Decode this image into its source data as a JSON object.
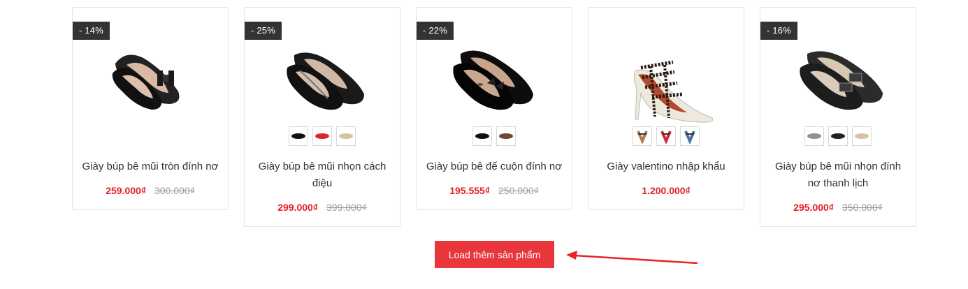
{
  "products": [
    {
      "badge": "- 14%",
      "name": "Giày búp bê mũi tròn đính nơ",
      "price": "259.000₫",
      "old_price": "300.000₫"
    },
    {
      "badge": "- 25%",
      "name": "Giày búp bê mũi nhọn cách điệu",
      "price": "299.000₫",
      "old_price": "399.000₫"
    },
    {
      "badge": "- 22%",
      "name": "Giày búp bê đế cuộn đính nơ",
      "price": "195.555₫",
      "old_price": "250.000₫"
    },
    {
      "badge": "",
      "name": "Giày valentino nhập khẩu",
      "price": "1.200.000₫",
      "old_price": ""
    },
    {
      "badge": "- 16%",
      "name": "Giày búp bê mũi nhọn đính nơ thanh lịch",
      "price": "295.000₫",
      "old_price": "350.000₫"
    }
  ],
  "load_more_label": "Load thêm sản phẩm",
  "colors": {
    "accent": "#e8363b",
    "price": "#e31e24",
    "badge": "#333333"
  }
}
